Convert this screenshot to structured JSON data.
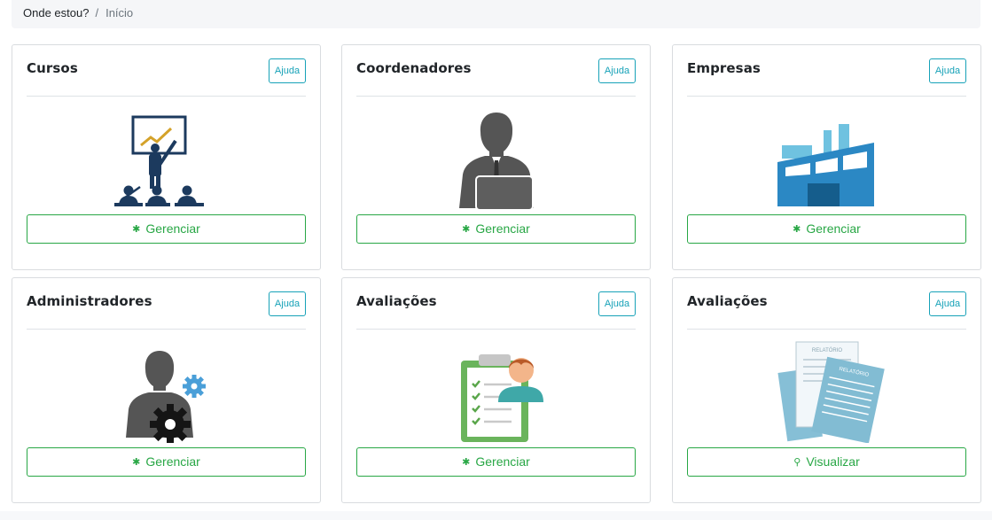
{
  "breadcrumb": {
    "label": "Onde estou?",
    "separator": "/",
    "current": "Início"
  },
  "cards": [
    {
      "title": "Cursos",
      "help": "Ajuda",
      "action": "Gerenciar",
      "icon": "gear-icon",
      "illustration": "classroom-presentation-illustration"
    },
    {
      "title": "Coordenadores",
      "help": "Ajuda",
      "action": "Gerenciar",
      "icon": "gear-icon",
      "illustration": "coordinator-at-laptop-illustration"
    },
    {
      "title": "Empresas",
      "help": "Ajuda",
      "action": "Gerenciar",
      "icon": "gear-icon",
      "illustration": "factory-building-illustration"
    },
    {
      "title": "Administradores",
      "help": "Ajuda",
      "action": "Gerenciar",
      "icon": "gear-icon",
      "illustration": "admin-with-gears-illustration"
    },
    {
      "title": "Avaliações",
      "help": "Ajuda",
      "action": "Gerenciar",
      "icon": "gear-icon",
      "illustration": "checklist-clipboard-illustration"
    },
    {
      "title": "Avaliações",
      "help": "Ajuda",
      "action": "Visualizar",
      "icon": "magnifier-icon",
      "illustration": "report-documents-illustration"
    }
  ],
  "report_label": "RELATÓRIO",
  "colors": {
    "accent_green": "#28a745",
    "help_teal": "#17a2b8",
    "border": "#d9dcdf"
  }
}
